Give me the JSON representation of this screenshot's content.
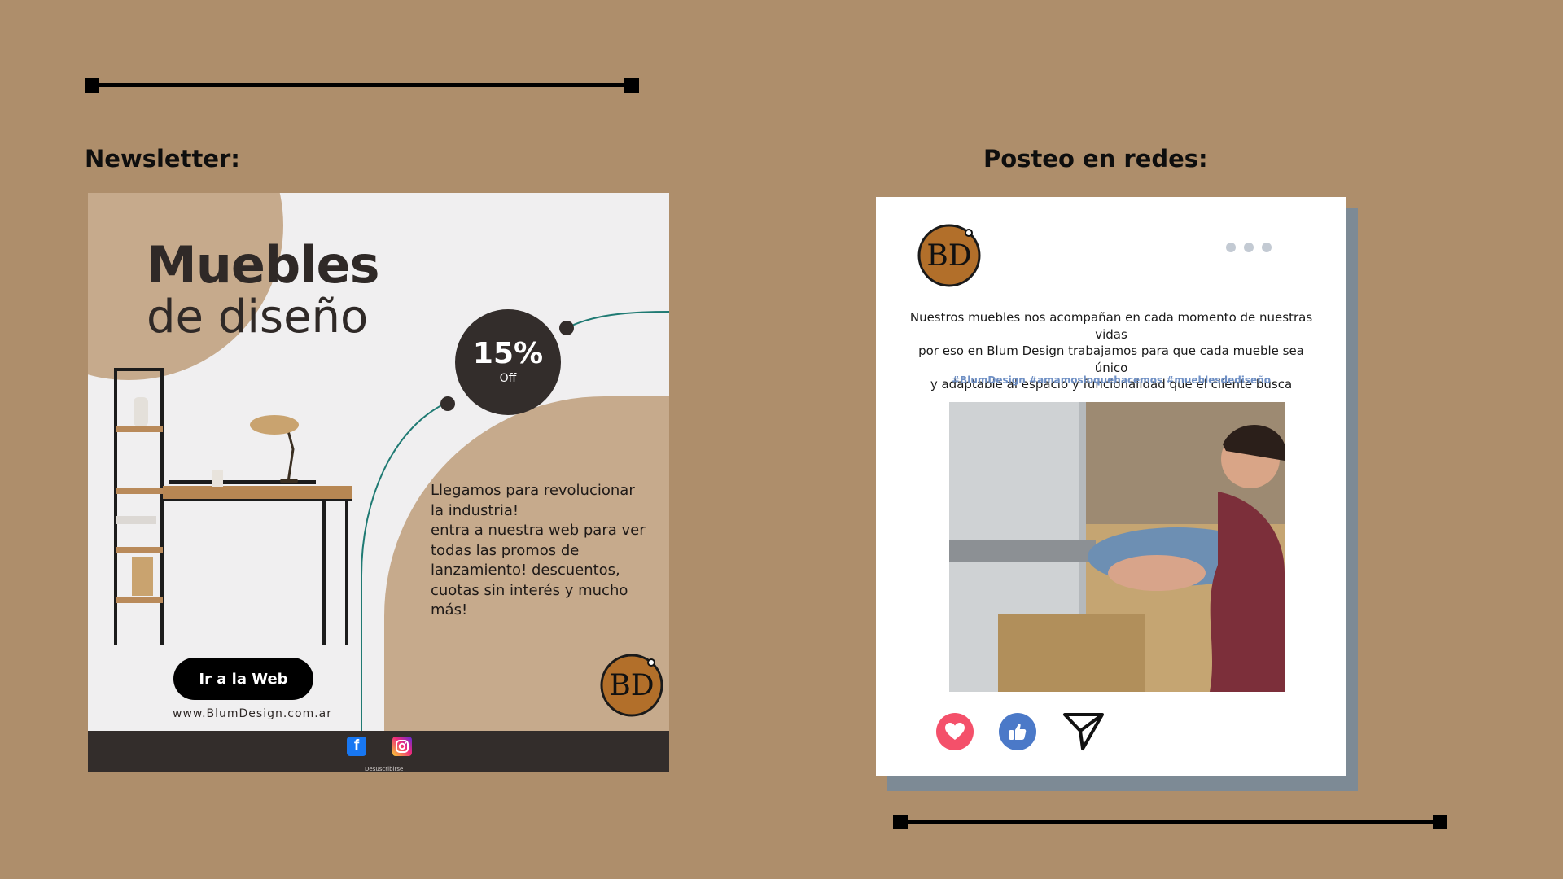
{
  "page": {
    "background_color": "#ae8e6b"
  },
  "sections": {
    "newsletter_title": "Newsletter:",
    "post_title": "Posteo en redes:"
  },
  "newsletter": {
    "heading_bold": "Muebles",
    "heading_light": "de diseño",
    "discount": {
      "value": "15%",
      "label": "Off"
    },
    "body": "Llegamos para revolucionar la industria!\nentra a nuestra web para ver todas las promos de lanzamiento! descuentos, cuotas sin interés y mucho más!",
    "cta_label": "Ir a la Web",
    "url": "www.BlumDesign.com.ar",
    "logo_text": "BD",
    "footer": {
      "facebook_icon": "facebook-icon",
      "instagram_icon": "instagram-icon",
      "facebook_glyph": "f",
      "unsubscribe": "Desuscribirse"
    },
    "colors": {
      "tan": "#c6aa8c",
      "dark": "#332d2b",
      "accent_line": "#1f7a73",
      "background": "#f0eff0"
    }
  },
  "post": {
    "logo_text": "BD",
    "caption": "Nuestros muebles nos acompañan en cada momento de nuestras vidas\npor eso en Blum Design trabajamos para que cada mueble sea único\ny adaptable al espacio y funcionalidad que el cliente busca",
    "hashtags": "#BlumDesign #amamosloquehacemos #mueblesdediseño",
    "actions": [
      "heart-icon",
      "thumbs-up-icon",
      "send-icon"
    ],
    "colors": {
      "hashtag": "#6e8fc4",
      "like": "#f4506a",
      "thumb": "#4b79c8",
      "shadow": "#7d8a95"
    }
  }
}
